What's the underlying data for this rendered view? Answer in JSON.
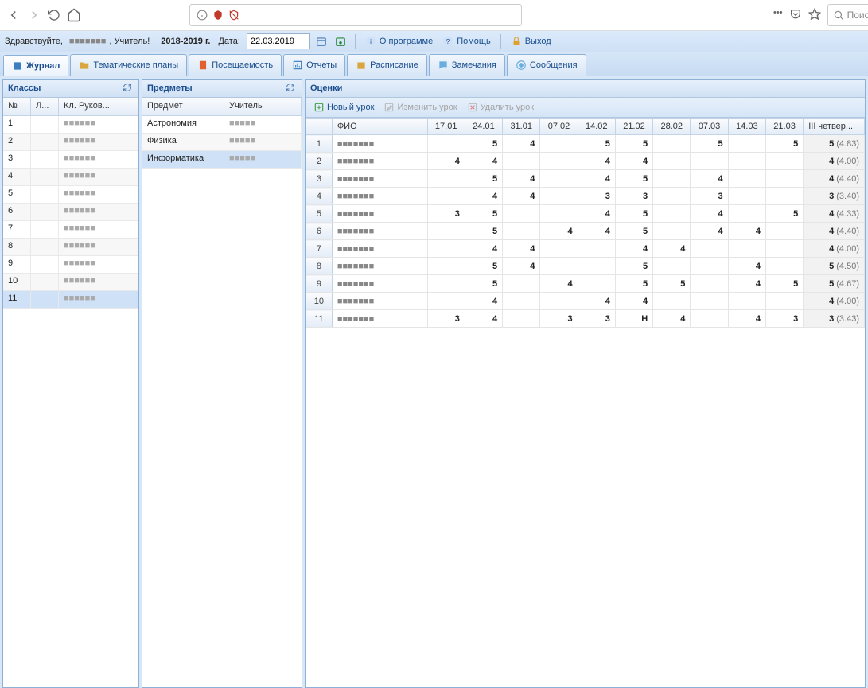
{
  "browser": {
    "search_placeholder": "Поиск"
  },
  "header": {
    "greeting": "Здравствуйте,",
    "role": ", Учитель!",
    "year": "2018-2019 г.",
    "date_label": "Дата:",
    "date_value": "22.03.2019",
    "about": "О программе",
    "help": "Помощь",
    "exit": "Выход"
  },
  "tabs": [
    {
      "label": "Журнал"
    },
    {
      "label": "Тематические планы"
    },
    {
      "label": "Посещаемость"
    },
    {
      "label": "Отчеты"
    },
    {
      "label": "Расписание"
    },
    {
      "label": "Замечания"
    },
    {
      "label": "Сообщения"
    }
  ],
  "classes_panel": {
    "title": "Классы",
    "cols": [
      "№",
      "Л...",
      "Кл. Руков..."
    ],
    "rows": [
      {
        "num": "1"
      },
      {
        "num": "2"
      },
      {
        "num": "3"
      },
      {
        "num": "4"
      },
      {
        "num": "5"
      },
      {
        "num": "6"
      },
      {
        "num": "7"
      },
      {
        "num": "8"
      },
      {
        "num": "9"
      },
      {
        "num": "10"
      },
      {
        "num": "11"
      }
    ],
    "selected_index": 10
  },
  "subjects_panel": {
    "title": "Предметы",
    "cols": [
      "Предмет",
      "Учитель"
    ],
    "rows": [
      {
        "subj": "Астрономия"
      },
      {
        "subj": "Физика"
      },
      {
        "subj": "Информатика"
      }
    ],
    "selected_index": 2
  },
  "grades_panel": {
    "title": "Оценки",
    "toolbar": {
      "new": "Новый урок",
      "edit": "Изменить урок",
      "del": "Удалить урок"
    },
    "columns": [
      "ФИО",
      "17.01",
      "24.01",
      "31.01",
      "07.02",
      "14.02",
      "21.02",
      "28.02",
      "07.03",
      "14.03",
      "21.03",
      "III четвер..."
    ],
    "rows": [
      {
        "marks": [
          "",
          "5",
          "4",
          "",
          "5",
          "5",
          "",
          "5",
          "",
          "5"
        ],
        "total": "5",
        "avg": "(4.83)"
      },
      {
        "marks": [
          "4",
          "4",
          "",
          "",
          "4",
          "4",
          "",
          "",
          "",
          ""
        ],
        "total": "4",
        "avg": "(4.00)"
      },
      {
        "marks": [
          "",
          "5",
          "4",
          "",
          "4",
          "5",
          "",
          "4",
          "",
          ""
        ],
        "total": "4",
        "avg": "(4.40)"
      },
      {
        "marks": [
          "",
          "4",
          "4",
          "",
          "3",
          "3",
          "",
          "3",
          "",
          ""
        ],
        "total": "3",
        "avg": "(3.40)"
      },
      {
        "marks": [
          "3",
          "5",
          "",
          "",
          "4",
          "5",
          "",
          "4",
          "",
          "5"
        ],
        "total": "4",
        "avg": "(4.33)"
      },
      {
        "marks": [
          "",
          "5",
          "",
          "4",
          "4",
          "5",
          "",
          "4",
          "4",
          ""
        ],
        "total": "4",
        "avg": "(4.40)"
      },
      {
        "marks": [
          "",
          "4",
          "4",
          "",
          "",
          "4",
          "4",
          "",
          "",
          ""
        ],
        "total": "4",
        "avg": "(4.00)"
      },
      {
        "marks": [
          "",
          "5",
          "4",
          "",
          "",
          "5",
          "",
          "",
          "4",
          ""
        ],
        "total": "5",
        "avg": "(4.50)"
      },
      {
        "marks": [
          "",
          "5",
          "",
          "4",
          "",
          "5",
          "5",
          "",
          "4",
          "5"
        ],
        "total": "5",
        "avg": "(4.67)"
      },
      {
        "marks": [
          "",
          "4",
          "",
          "",
          "4",
          "4",
          "",
          "",
          "",
          ""
        ],
        "total": "4",
        "avg": "(4.00)"
      },
      {
        "marks": [
          "3",
          "4",
          "",
          "3",
          "3",
          "Н",
          "4",
          "",
          "4",
          "3"
        ],
        "total": "3",
        "avg": "(3.43)"
      }
    ]
  }
}
